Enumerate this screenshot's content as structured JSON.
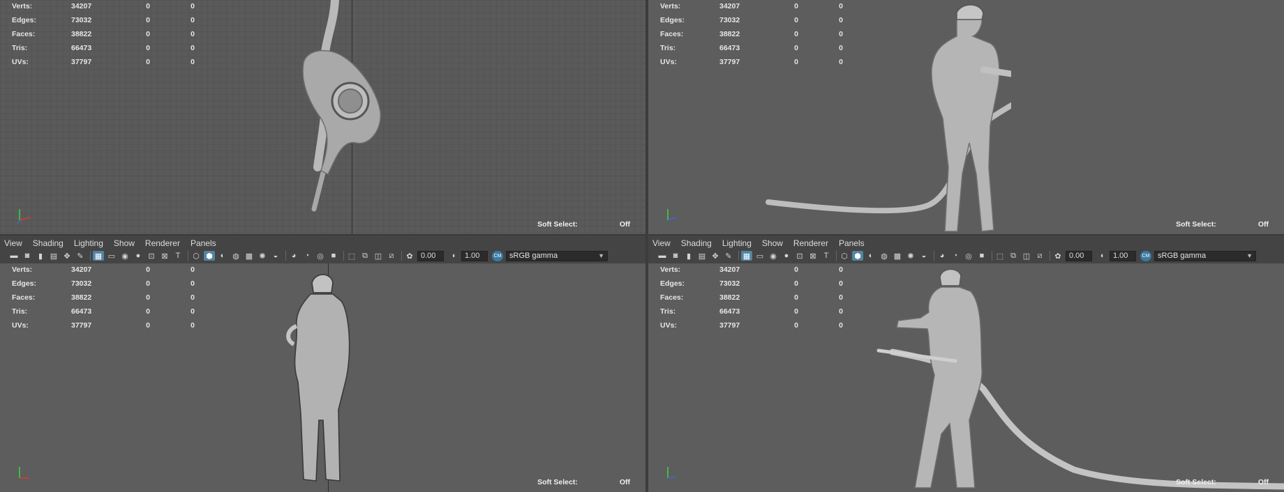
{
  "hud": {
    "rows": [
      {
        "label": "Verts:",
        "value": "34207",
        "a": "0",
        "b": "0"
      },
      {
        "label": "Edges:",
        "value": "73032",
        "a": "0",
        "b": "0"
      },
      {
        "label": "Faces:",
        "value": "38822",
        "a": "0",
        "b": "0"
      },
      {
        "label": "Tris:",
        "value": "66473",
        "a": "0",
        "b": "0"
      },
      {
        "label": "UVs:",
        "value": "37797",
        "a": "0",
        "b": "0"
      }
    ],
    "soft_select_label": "Soft Select:",
    "soft_select_value": "Off"
  },
  "panel_menu": {
    "view": "View",
    "shading": "Shading",
    "lighting": "Lighting",
    "show": "Show",
    "renderer": "Renderer",
    "panels": "Panels"
  },
  "toolbar": {
    "exposure": "0.00",
    "gamma": "1.00",
    "color_space": "sRGB gamma",
    "cm_badge": "CM"
  },
  "colors": {
    "viewport_bg": "#5d5d5d",
    "ui_bg": "#444444",
    "active_icon": "#5285a6",
    "axis_x": "#d83a3a",
    "axis_y": "#3ad83a",
    "axis_z": "#3a6ad8"
  },
  "icons": [
    "camera-icon",
    "grid-icon",
    "wireframe-icon",
    "smooth-shade-icon",
    "lighting-icon",
    "shadow-icon",
    "isolate-icon",
    "xray-icon",
    "exposure-icon",
    "gamma-icon"
  ]
}
